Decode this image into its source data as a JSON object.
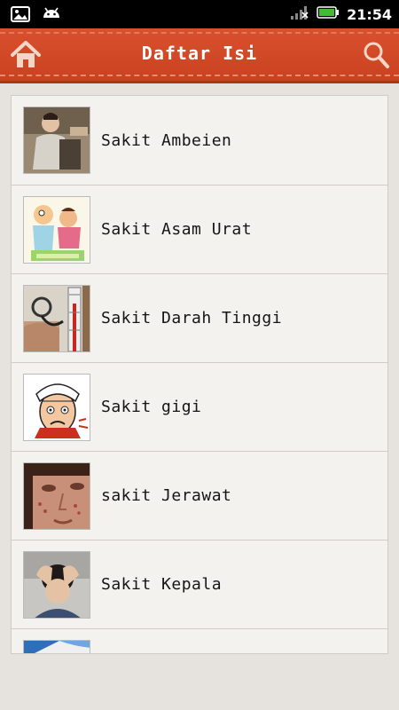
{
  "status_bar": {
    "time": "21:54",
    "icons": [
      "image-notification-icon",
      "android-notification-icon",
      "signal-icon",
      "battery-icon"
    ],
    "battery_color": "#3fbf2f"
  },
  "app_bar": {
    "title": "Daftar Isi",
    "home_icon": "home-icon",
    "search_icon": "search-icon",
    "color": "#d24a28"
  },
  "list": {
    "items": [
      {
        "label": "Sakit Ambeien",
        "thumb": "person-in-pain"
      },
      {
        "label": "Sakit Asam Urat",
        "thumb": "cartoon-elderly"
      },
      {
        "label": "Sakit Darah Tinggi",
        "thumb": "blood-pressure-meter"
      },
      {
        "label": "Sakit gigi",
        "thumb": "cartoon-toothache"
      },
      {
        "label": "sakit Jerawat",
        "thumb": "acne-face"
      },
      {
        "label": "Sakit Kepala",
        "thumb": "headache-person"
      },
      {
        "label": "",
        "thumb": "partial-blue-image"
      }
    ]
  }
}
